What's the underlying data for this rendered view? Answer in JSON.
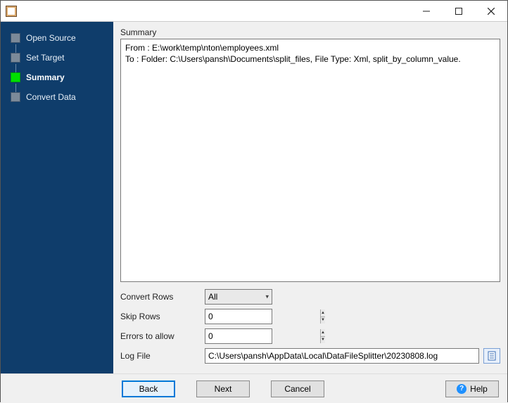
{
  "steps": [
    {
      "label": "Open Source",
      "current": false
    },
    {
      "label": "Set Target",
      "current": false
    },
    {
      "label": "Summary",
      "current": true
    },
    {
      "label": "Convert Data",
      "current": false
    }
  ],
  "summary": {
    "heading": "Summary",
    "from_label": "From : ",
    "from_value": "E:\\work\\temp\\nton\\employees.xml",
    "to_label": "To : ",
    "to_value": "Folder: C:\\Users\\pansh\\Documents\\split_files, File Type: Xml, split_by_column_value."
  },
  "form": {
    "convert_rows_label": "Convert Rows",
    "convert_rows_value": "All",
    "skip_rows_label": "Skip Rows",
    "skip_rows_value": "0",
    "errors_label": "Errors to allow",
    "errors_value": "0",
    "logfile_label": "Log File",
    "logfile_value": "C:\\Users\\pansh\\AppData\\Local\\DataFileSplitter\\20230808.log"
  },
  "buttons": {
    "back": "Back",
    "next": "Next",
    "cancel": "Cancel",
    "help": "Help"
  }
}
